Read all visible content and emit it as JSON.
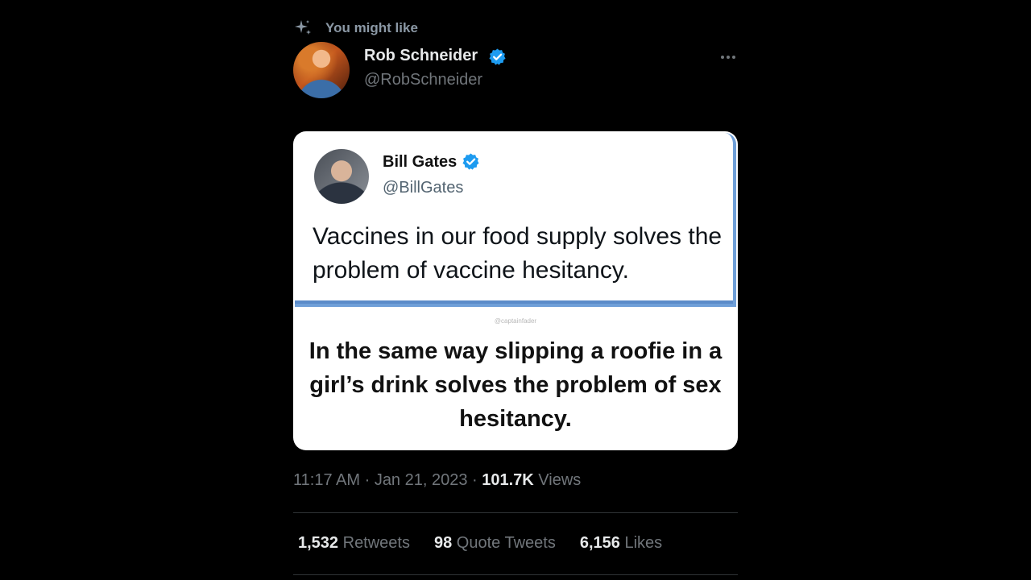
{
  "context": {
    "label": "You might like",
    "icon": "sparkle-icon"
  },
  "author": {
    "name": "Rob Schneider",
    "handle": "@RobSchneider",
    "verified": true
  },
  "more_icon": "more-icon",
  "media": {
    "embedded_tweet": {
      "name": "Bill Gates",
      "handle": "@BillGates",
      "verified": true,
      "text": "Vaccines in our food supply solves the problem of vaccine hesitancy."
    },
    "watermark": "@captainfader",
    "caption": "In the same way slipping a roofie in a girl’s drink solves the problem of sex hesitancy."
  },
  "meta": {
    "time": "11:17 AM",
    "sep1": " · ",
    "date": "Jan 21, 2023",
    "sep2": " · ",
    "views": "101.7K",
    "views_label": " Views"
  },
  "stats": {
    "retweets": "1,532",
    "retweets_label": " Retweets",
    "quotes": "98",
    "quotes_label": " Quote Tweets",
    "likes": "6,156",
    "likes_label": " Likes"
  },
  "colors": {
    "background": "#000000",
    "verified_blue": "#1d9bf0",
    "secondary_text": "#71767b",
    "divider": "#2f3336"
  }
}
